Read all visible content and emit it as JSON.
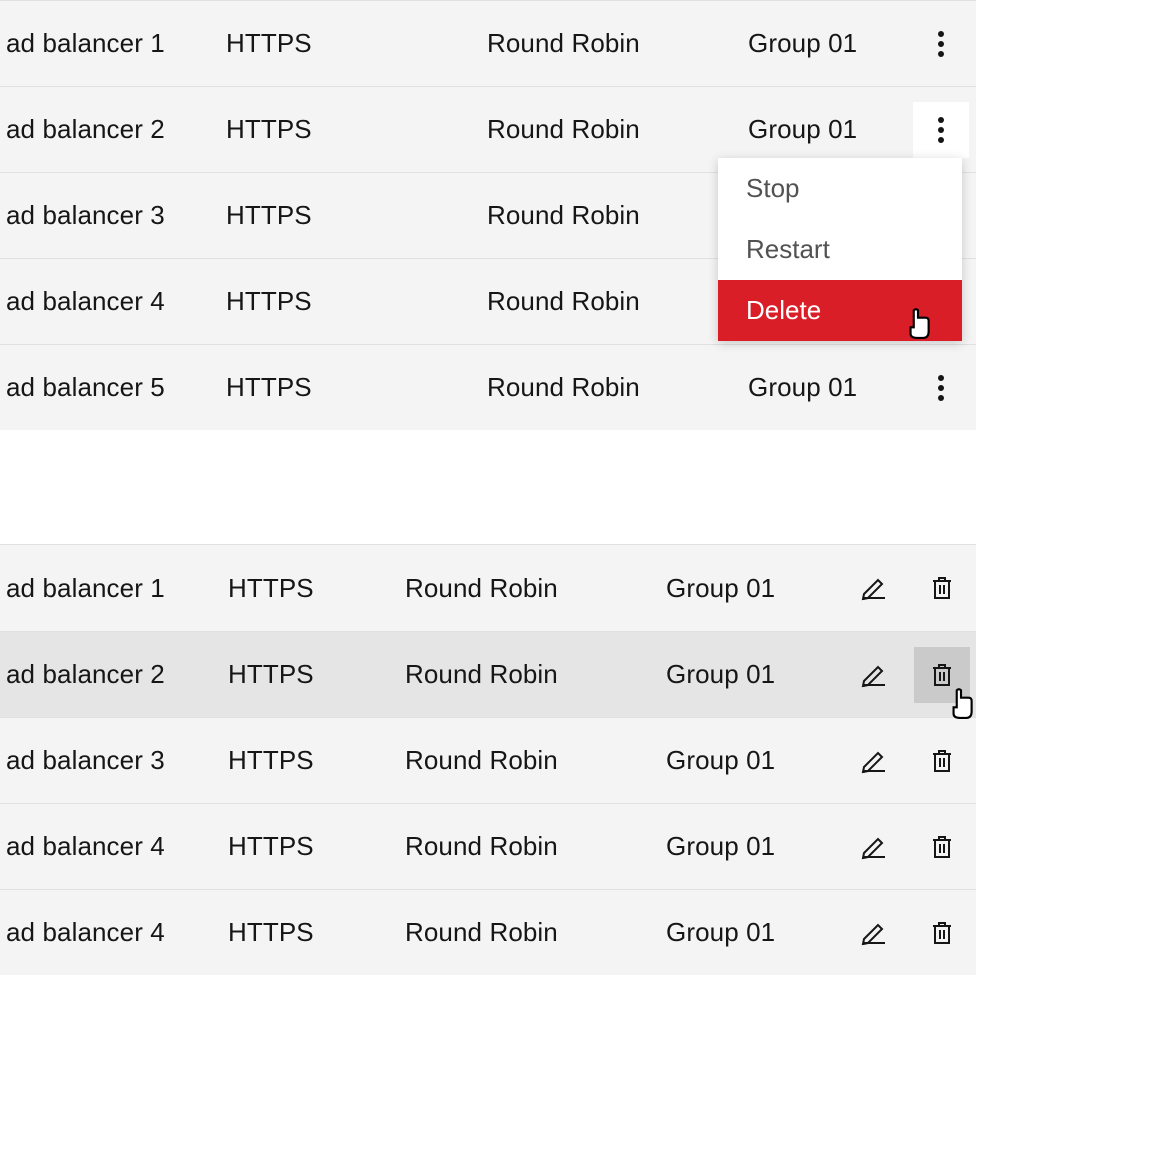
{
  "table1": {
    "rows": [
      {
        "name": "ad balancer 1",
        "protocol": "HTTPS",
        "policy": "Round Robin",
        "group": "Group 01"
      },
      {
        "name": "ad balancer 2",
        "protocol": "HTTPS",
        "policy": "Round Robin",
        "group": "Group 01",
        "menuOpen": true
      },
      {
        "name": "ad balancer 3",
        "protocol": "HTTPS",
        "policy": "Round Robin",
        "group": ""
      },
      {
        "name": "ad balancer 4",
        "protocol": "HTTPS",
        "policy": "Round Robin",
        "group": ""
      },
      {
        "name": "ad balancer 5",
        "protocol": "HTTPS",
        "policy": "Round Robin",
        "group": "Group 01"
      }
    ],
    "menu": {
      "items": [
        {
          "label": "Stop",
          "danger": false
        },
        {
          "label": "Restart",
          "danger": false
        },
        {
          "label": "Delete",
          "danger": true
        }
      ]
    }
  },
  "table2": {
    "rows": [
      {
        "name": "ad balancer 1",
        "protocol": "HTTPS",
        "policy": "Round Robin",
        "group": "Group 01"
      },
      {
        "name": "ad balancer 2",
        "protocol": "HTTPS",
        "policy": "Round Robin",
        "group": "Group 01",
        "hover": true,
        "trashActive": true
      },
      {
        "name": "ad balancer 3",
        "protocol": "HTTPS",
        "policy": "Round Robin",
        "group": "Group 01"
      },
      {
        "name": "ad balancer 4",
        "protocol": "HTTPS",
        "policy": "Round Robin",
        "group": "Group 01"
      },
      {
        "name": "ad balancer 4",
        "protocol": "HTTPS",
        "policy": "Round Robin",
        "group": "Group 01"
      }
    ]
  },
  "colors": {
    "danger": "#da1e28",
    "rowBg": "#f4f4f4",
    "rowHover": "#e5e5e5",
    "border": "#e0e0e0"
  }
}
